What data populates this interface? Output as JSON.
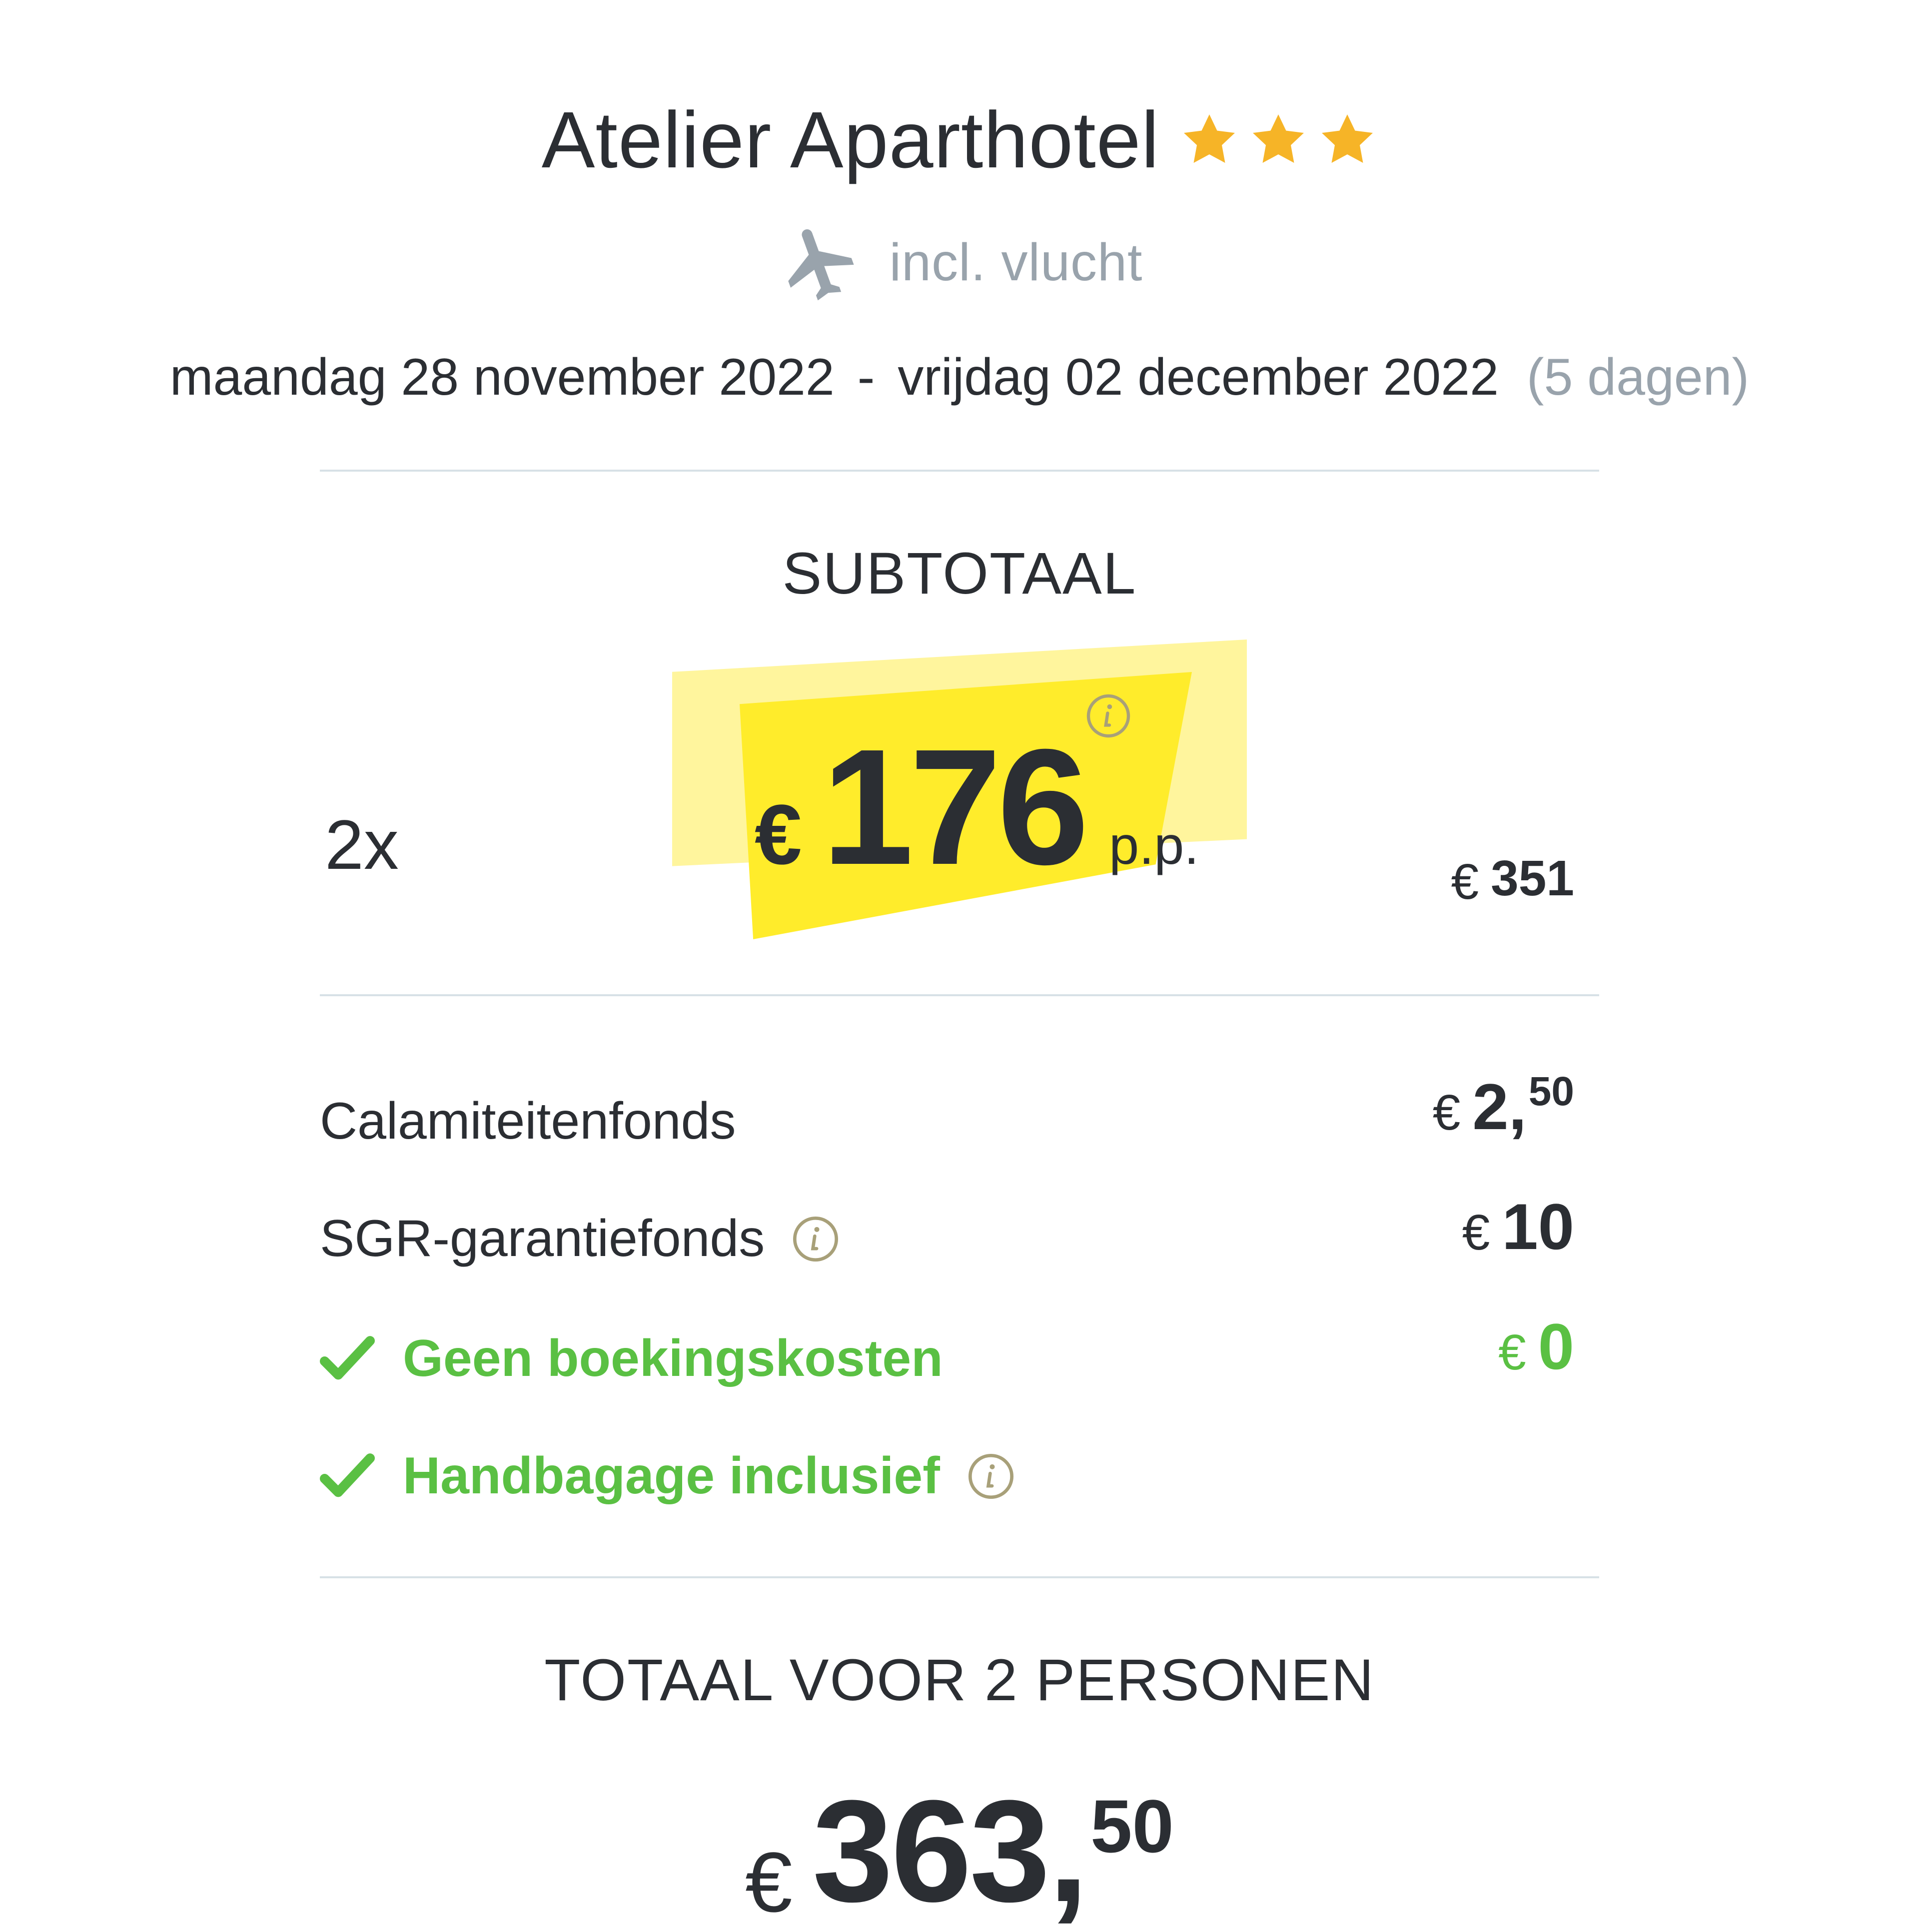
{
  "header": {
    "hotel_name": "Atelier Aparthotel",
    "star_rating": 3,
    "star_color": "#f6b427",
    "flight_icon": "plane-icon",
    "flight_label": "incl. vlucht"
  },
  "dates": {
    "start": "maandag 28 november 2022",
    "separator": "-",
    "end": "vrijdag 02 december 2022",
    "duration": "(5 dagen)"
  },
  "subtotal": {
    "title": "SUBTOTAAL",
    "quantity": "2x",
    "price_currency": "€",
    "price_per_person": "176",
    "per_person_label": "p.p.",
    "highlight_color": "#ffec2b",
    "total_currency": "€",
    "total_amount": "351"
  },
  "fees": [
    {
      "label": "Calamiteitenfonds",
      "currency": "€",
      "amount_main": "2,",
      "amount_cents": "50"
    },
    {
      "label": "SGR-garantiefonds",
      "currency": "€",
      "amount_main": "10",
      "info_icon": "info-icon"
    },
    {
      "label": "Geen boekingskosten",
      "currency": "€",
      "amount_main": "0",
      "icon": "check-icon",
      "color": "#5ac043"
    },
    {
      "label": "Handbagage inclusief",
      "icon": "check-icon",
      "info_icon": "info-icon",
      "color": "#5ac043"
    }
  ],
  "total": {
    "title": "TOTAAL VOOR 2 PERSONEN",
    "currency": "€",
    "amount_main": "363,",
    "amount_cents": "50"
  }
}
